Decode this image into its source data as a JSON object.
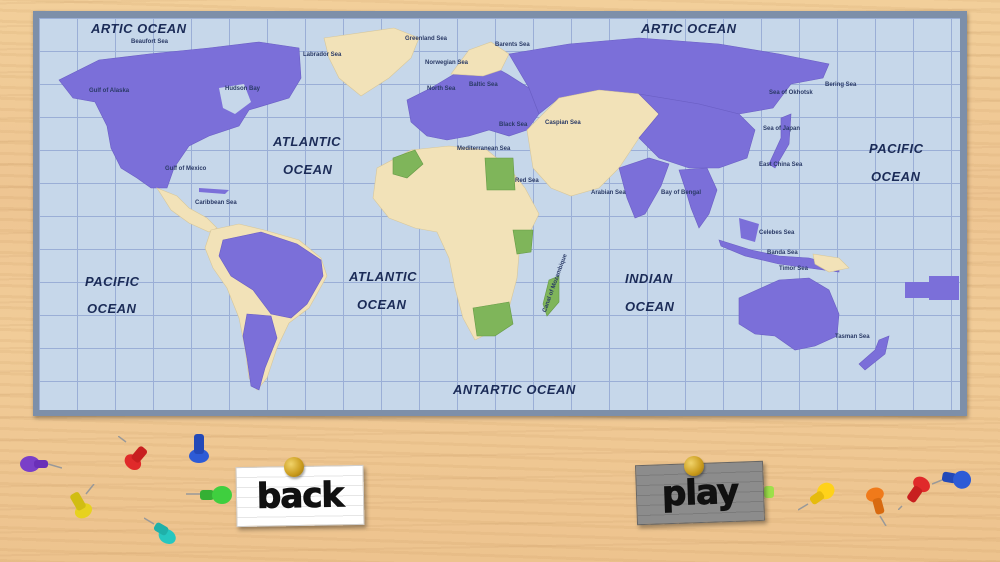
{
  "map": {
    "ocean_labels": [
      {
        "id": "artic-w",
        "text": "ARTIC      OCEAN"
      },
      {
        "id": "artic-e",
        "text": "ARTIC      OCEAN"
      },
      {
        "id": "atlantic-n-1",
        "text": "ATLANTIC"
      },
      {
        "id": "atlantic-n-2",
        "text": "OCEAN"
      },
      {
        "id": "pacific-e-1",
        "text": "PACIFIC"
      },
      {
        "id": "pacific-e-2",
        "text": "OCEAN"
      },
      {
        "id": "pacific-w-1",
        "text": "PACIFIC"
      },
      {
        "id": "pacific-w-2",
        "text": "OCEAN"
      },
      {
        "id": "atlantic-s-1",
        "text": "ATLANTIC"
      },
      {
        "id": "atlantic-s-2",
        "text": "OCEAN"
      },
      {
        "id": "indian-1",
        "text": "INDIAN"
      },
      {
        "id": "indian-2",
        "text": "OCEAN"
      },
      {
        "id": "antartic",
        "text": "ANTARTIC      OCEAN"
      }
    ],
    "sea_labels": [
      "Beaufort Sea",
      "Hudson Bay",
      "Gulf of Alaska",
      "Labrador Sea",
      "Greenland Sea",
      "Barents Sea",
      "Norwegian Sea",
      "North Sea",
      "Baltic Sea",
      "Black Sea",
      "Mediterranean Sea",
      "Caspian Sea",
      "Red Sea",
      "Arabian Sea",
      "Bay of Bengal",
      "Sea of Okhotsk",
      "Bering Sea",
      "Sea of Japan",
      "East China Sea",
      "Celebes Sea",
      "Banda Sea",
      "Timor Sea",
      "Tasman Sea",
      "Gulf of Mexico",
      "Caribbean Sea",
      "Canal of Mozambique"
    ],
    "colors": {
      "water": "#c6d7ea",
      "grid": "#9aaed6",
      "land_neutral": "#f2e2b8",
      "land_purple": "#7b6fd9",
      "land_green": "#7fb55a",
      "frame": "#7d8fa9"
    }
  },
  "buttons": {
    "back_label": "back",
    "play_label": "play"
  },
  "decor": {
    "pushpin_colors": [
      "#7a3fc8",
      "#e02a2a",
      "#2d5bd6",
      "#e7d21f",
      "#3fcf3f",
      "#26c7c0",
      "#9de04a",
      "#ffd21a",
      "#f07a1a",
      "#e02a2a",
      "#2d5bd6"
    ]
  }
}
